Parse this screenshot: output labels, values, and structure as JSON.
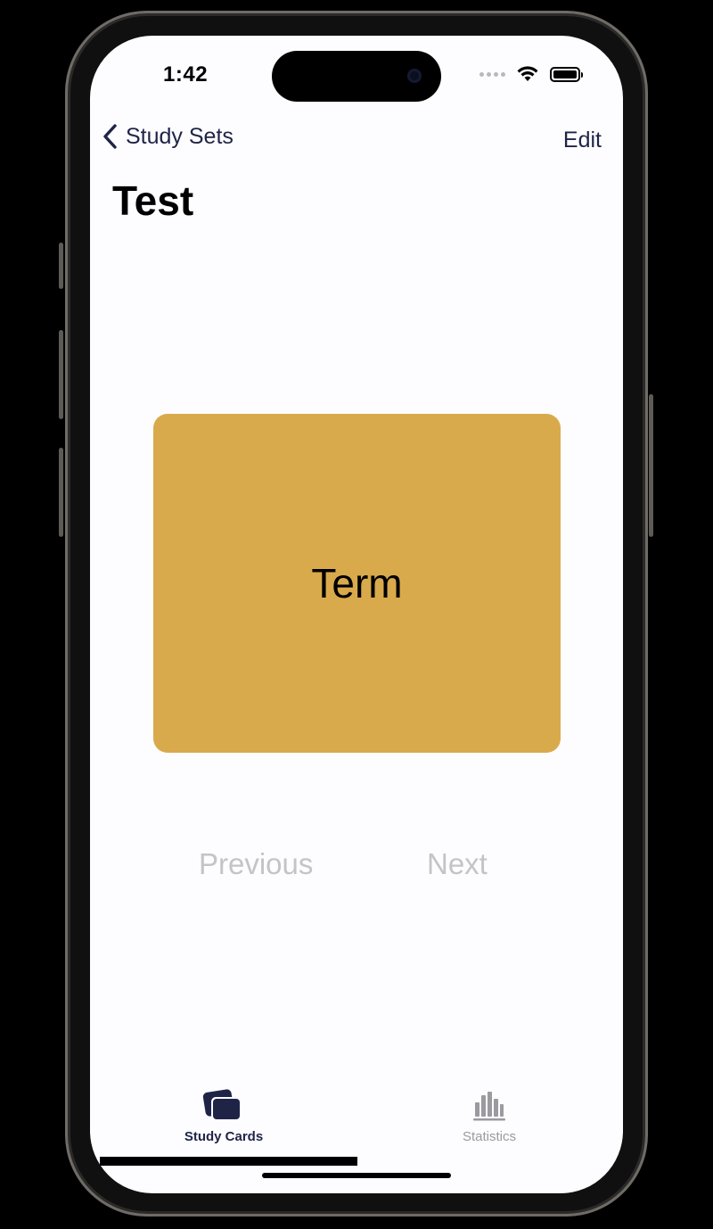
{
  "status_bar": {
    "time": "1:42"
  },
  "nav": {
    "back_label": "Study Sets",
    "edit_label": "Edit"
  },
  "page": {
    "title": "Test"
  },
  "card": {
    "text": "Term",
    "color": "#d9aa4c"
  },
  "controls": {
    "previous_label": "Previous",
    "next_label": "Next"
  },
  "tab_bar": {
    "tabs": [
      {
        "label": "Study Cards",
        "icon": "study-cards-icon",
        "active": true,
        "color": "#1f2447"
      },
      {
        "label": "Statistics",
        "icon": "bar-chart-icon",
        "active": false,
        "color": "#9a9a9f"
      }
    ]
  }
}
